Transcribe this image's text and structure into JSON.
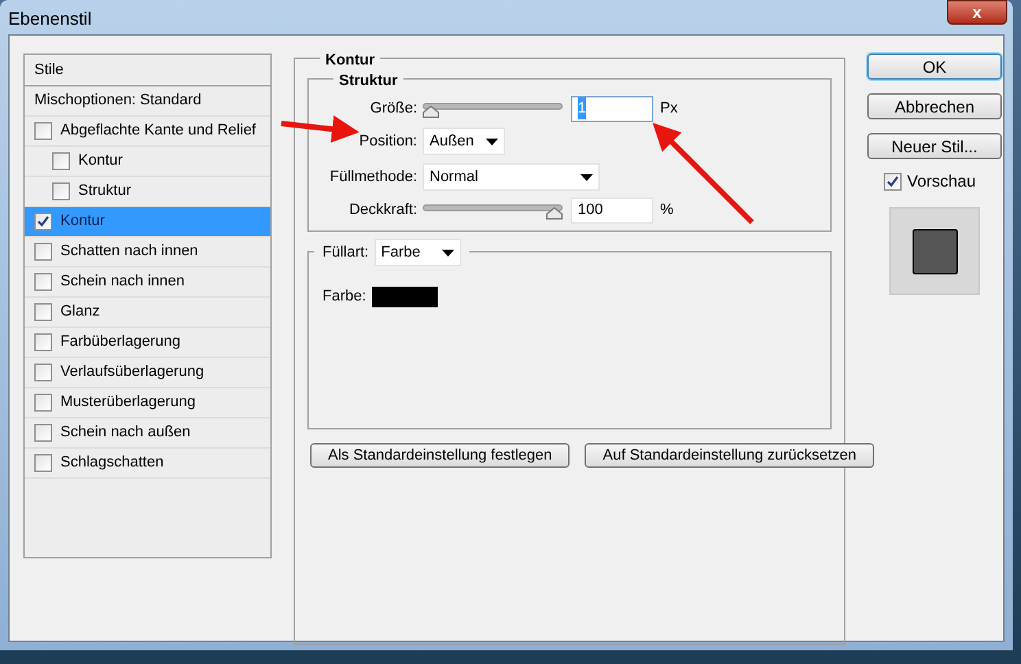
{
  "window": {
    "title": "Ebenenstil",
    "close_label": "x"
  },
  "styles_list": {
    "header": "Stile",
    "items": [
      {
        "label": "Mischoptionen: Standard",
        "kind": "plain",
        "selected": false
      },
      {
        "label": "Abgeflachte Kante und Relief",
        "kind": "checkbox",
        "checked": false,
        "selected": false,
        "children": [
          {
            "label": "Kontur",
            "kind": "checkbox",
            "checked": false,
            "selected": false
          },
          {
            "label": "Struktur",
            "kind": "checkbox",
            "checked": false,
            "selected": false
          }
        ]
      },
      {
        "label": "Kontur",
        "kind": "checkbox",
        "checked": true,
        "selected": true
      },
      {
        "label": "Schatten nach innen",
        "kind": "checkbox",
        "checked": false,
        "selected": false
      },
      {
        "label": "Schein nach innen",
        "kind": "checkbox",
        "checked": false,
        "selected": false
      },
      {
        "label": "Glanz",
        "kind": "checkbox",
        "checked": false,
        "selected": false
      },
      {
        "label": "Farbüberlagerung",
        "kind": "checkbox",
        "checked": false,
        "selected": false
      },
      {
        "label": "Verlaufsüberlagerung",
        "kind": "checkbox",
        "checked": false,
        "selected": false
      },
      {
        "label": "Musterüberlagerung",
        "kind": "checkbox",
        "checked": false,
        "selected": false
      },
      {
        "label": "Schein nach außen",
        "kind": "checkbox",
        "checked": false,
        "selected": false
      },
      {
        "label": "Schlagschatten",
        "kind": "checkbox",
        "checked": false,
        "selected": false
      }
    ]
  },
  "settings": {
    "title": "Kontur",
    "structure": {
      "title": "Struktur",
      "size": {
        "label": "Größe:",
        "level": 0,
        "value": "1",
        "unit": "Px",
        "value_highlighted": true
      },
      "position": {
        "label": "Position:",
        "value": "Außen"
      },
      "blend_mode": {
        "label": "Füllmethode:",
        "value": "Normal"
      },
      "opacity": {
        "label": "Deckkraft:",
        "level": 1,
        "value": "100",
        "unit": "%"
      }
    },
    "fill": {
      "label": "Füllart:",
      "value": "Farbe",
      "color_label": "Farbe:",
      "color": "#000000"
    },
    "buttons": [
      "Als Standardeinstellung festlegen",
      "Auf Standardeinstellung zurücksetzen"
    ]
  },
  "actions": [
    {
      "label": "OK",
      "default": true
    },
    {
      "label": "Abbrechen",
      "default": false
    },
    {
      "label": "Neuer Stil...",
      "default": false
    }
  ],
  "preview": {
    "label": "Vorschau",
    "checked": true
  }
}
